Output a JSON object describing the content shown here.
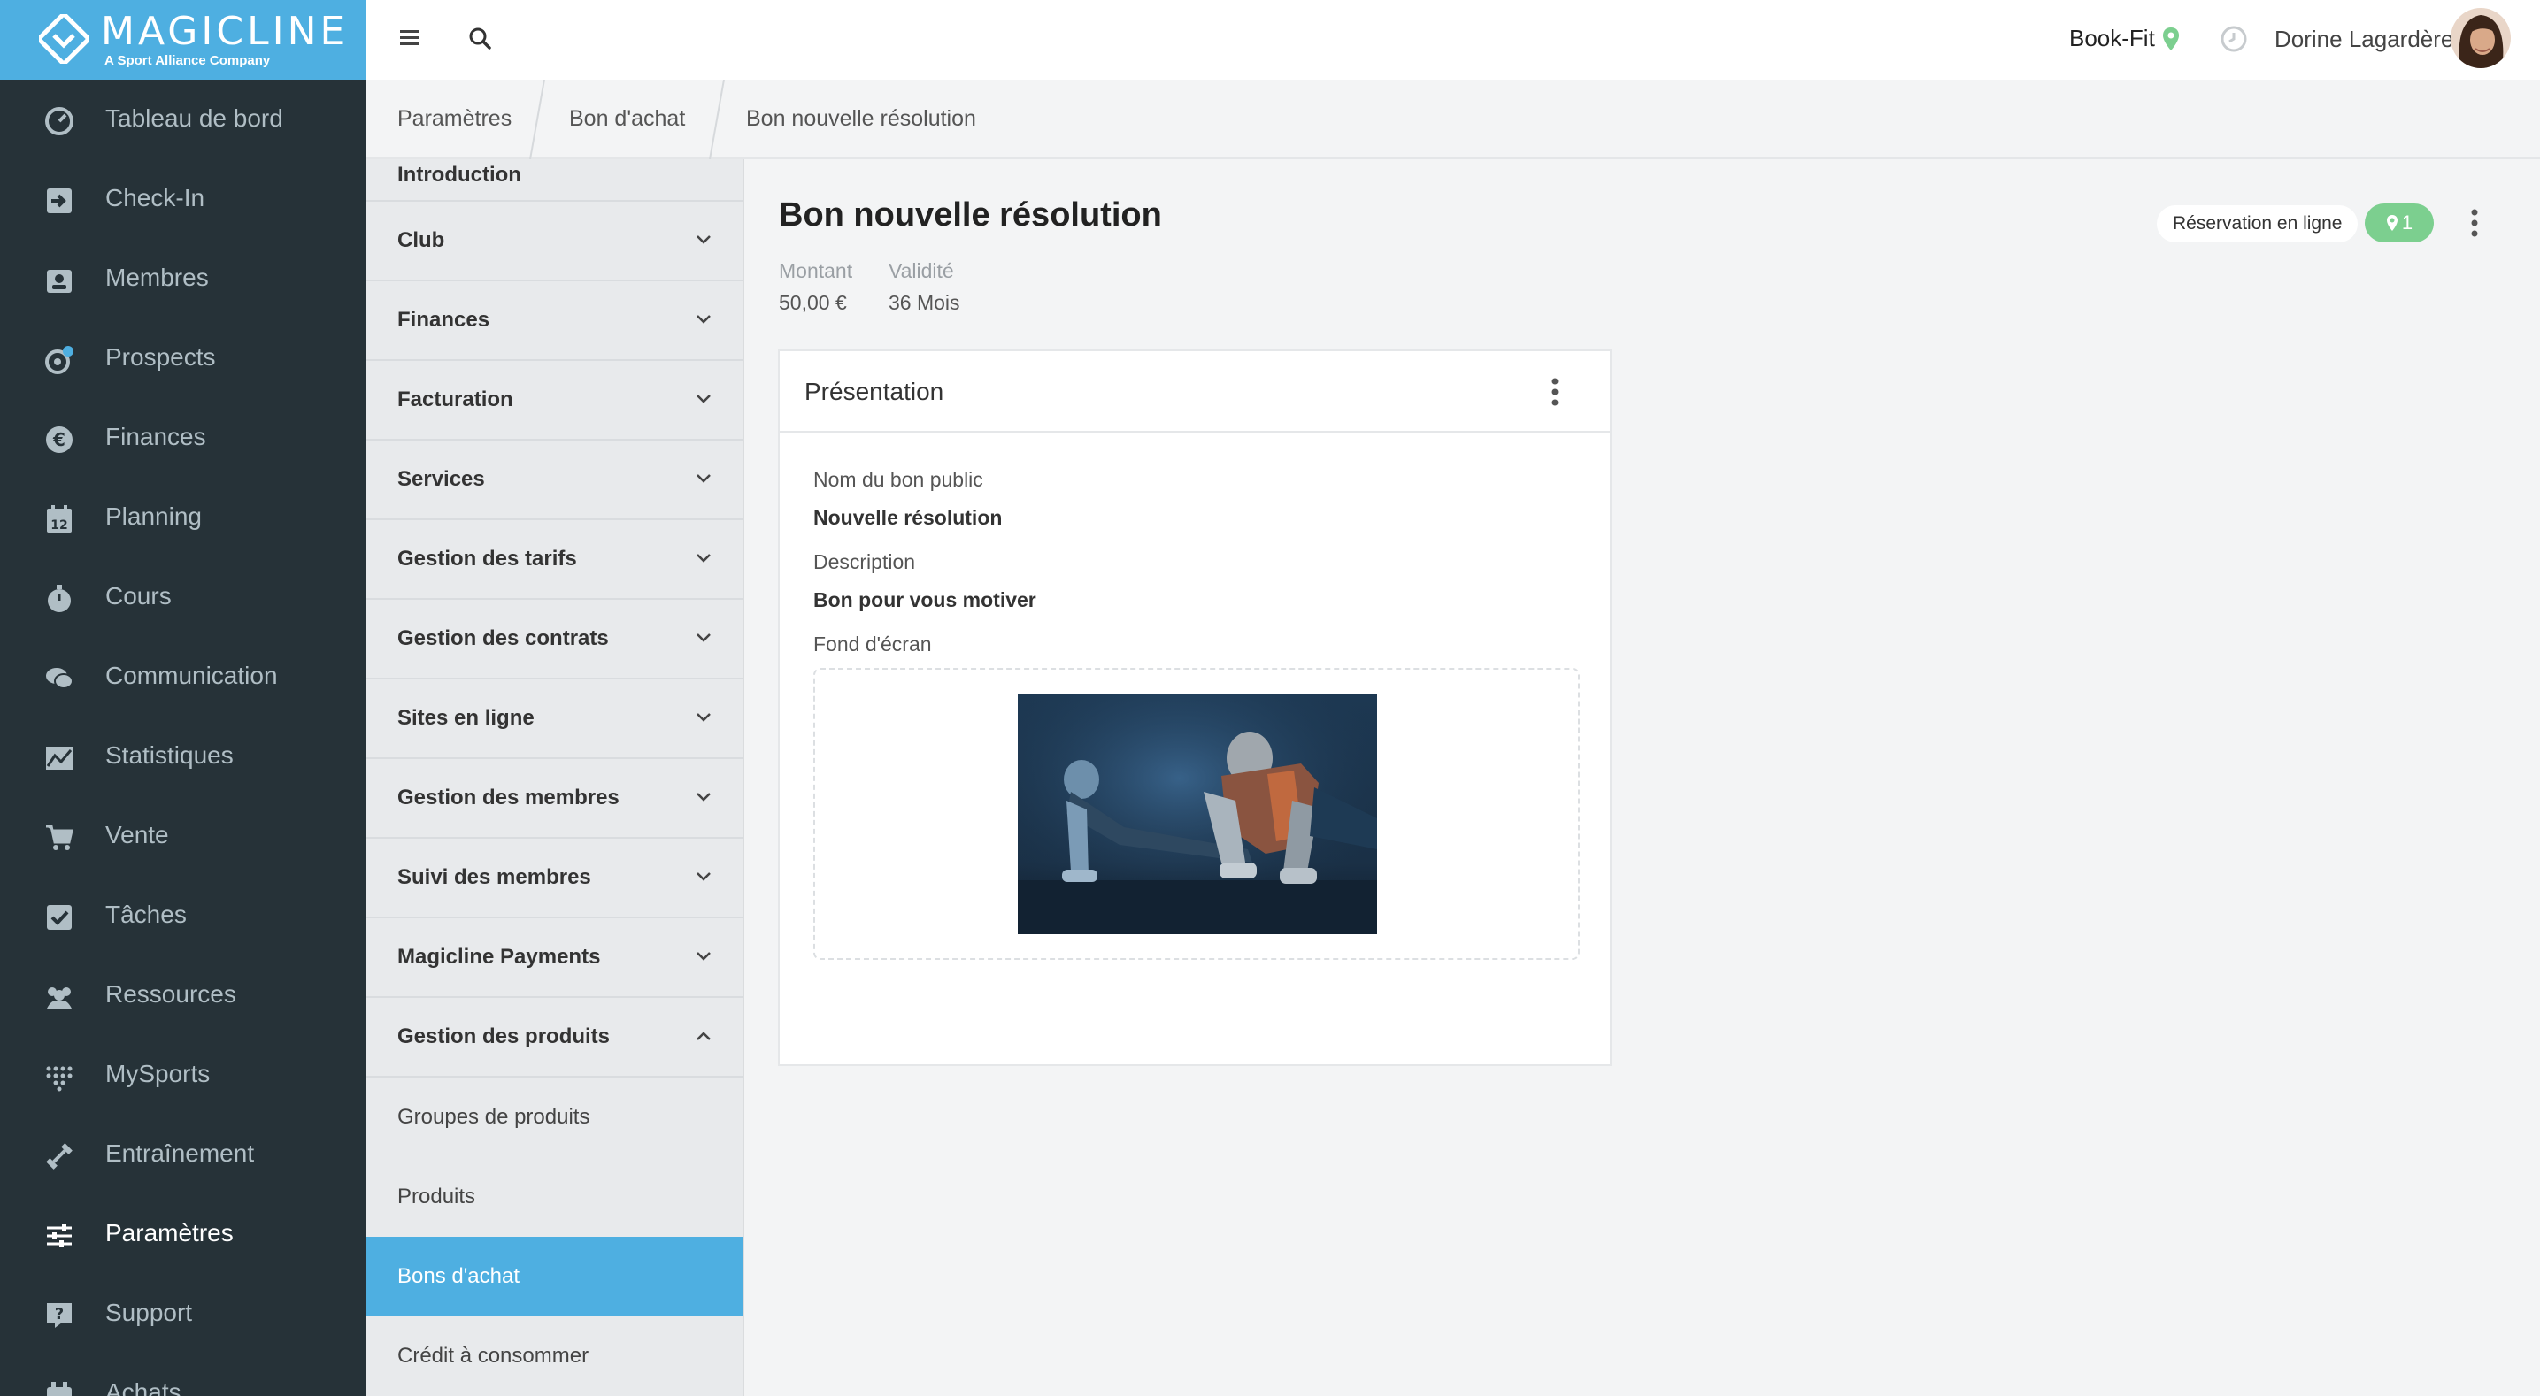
{
  "brand": {
    "name": "MAGICLINE",
    "tagline": "A Sport Alliance Company"
  },
  "nav": {
    "items": [
      {
        "label": "Tableau de bord",
        "icon": "dashboard-icon"
      },
      {
        "label": "Check-In",
        "icon": "check-in-icon"
      },
      {
        "label": "Membres",
        "icon": "members-icon"
      },
      {
        "label": "Prospects",
        "icon": "prospects-icon"
      },
      {
        "label": "Finances",
        "icon": "euro-icon"
      },
      {
        "label": "Planning",
        "icon": "calendar-icon"
      },
      {
        "label": "Cours",
        "icon": "stopwatch-icon"
      },
      {
        "label": "Communication",
        "icon": "chat-icon"
      },
      {
        "label": "Statistiques",
        "icon": "chart-icon"
      },
      {
        "label": "Vente",
        "icon": "cart-icon"
      },
      {
        "label": "Tâches",
        "icon": "task-icon"
      },
      {
        "label": "Ressources",
        "icon": "people-icon"
      },
      {
        "label": "MySports",
        "icon": "dots-grid-icon"
      },
      {
        "label": "Entraînement",
        "icon": "dumbbell-icon"
      },
      {
        "label": "Paramètres",
        "icon": "sliders-icon",
        "active": true
      },
      {
        "label": "Support",
        "icon": "help-icon"
      },
      {
        "label": "Achats",
        "icon": "purchases-icon"
      }
    ]
  },
  "topbar": {
    "studio": "Book-Fit",
    "user": "Dorine Lagardère"
  },
  "breadcrumb": [
    "Paramètres",
    "Bon d'achat",
    "Bon nouvelle résolution"
  ],
  "submenu": {
    "cut_item": "Introduction",
    "sections": [
      "Club",
      "Finances",
      "Facturation",
      "Services",
      "Gestion des tarifs",
      "Gestion des contrats",
      "Sites en ligne",
      "Gestion des membres",
      "Suivi des membres",
      "Magicline Payments",
      "Gestion des produits"
    ],
    "children": [
      "Groupes de produits",
      "Produits",
      "Bons d'achat",
      "Crédit à consommer"
    ],
    "active_child": "Bons d'achat"
  },
  "page": {
    "title": "Bon nouvelle résolution",
    "amount_label": "Montant",
    "amount_value": "50,00 €",
    "validity_label": "Validité",
    "validity_value": "36 Mois",
    "reservation_chip": "Réservation en ligne",
    "location_count": "1"
  },
  "card": {
    "title": "Présentation",
    "public_name_label": "Nom du bon public",
    "public_name_value": "Nouvelle résolution",
    "description_label": "Description",
    "description_value": "Bon pour vous motiver",
    "background_label": "Fond d'écran"
  },
  "colors": {
    "nav_bg": "#263238",
    "accent": "#4eafe1",
    "success": "#7ccf8f"
  }
}
